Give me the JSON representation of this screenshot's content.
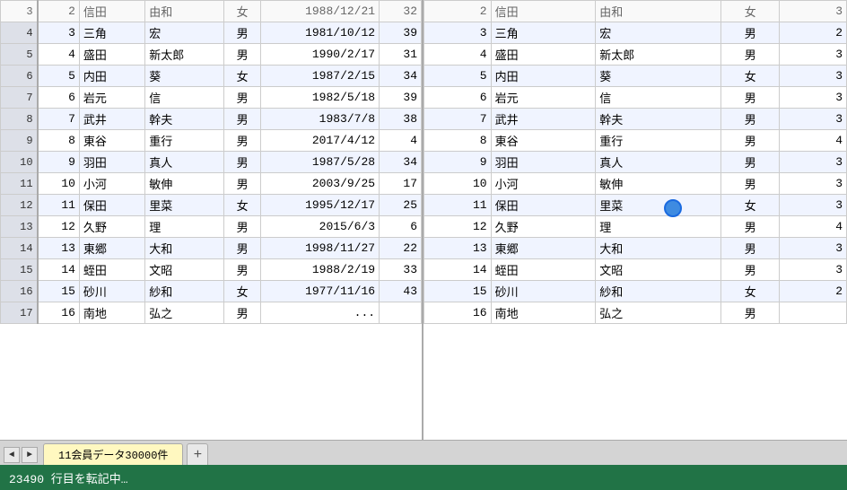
{
  "leftTable": {
    "rows": [
      {
        "rowNum": "3",
        "id": "2",
        "lastName": "信田",
        "firstName": "由和",
        "gender": "女",
        "date": "1988/12/21",
        "age": "32"
      },
      {
        "rowNum": "4",
        "id": "3",
        "lastName": "三角",
        "firstName": "宏",
        "gender": "男",
        "date": "1981/10/12",
        "age": "39"
      },
      {
        "rowNum": "5",
        "id": "4",
        "lastName": "盛田",
        "firstName": "新太郎",
        "gender": "男",
        "date": "1990/2/17",
        "age": "31"
      },
      {
        "rowNum": "6",
        "id": "5",
        "lastName": "内田",
        "firstName": "葵",
        "gender": "女",
        "date": "1987/2/15",
        "age": "34"
      },
      {
        "rowNum": "7",
        "id": "6",
        "lastName": "岩元",
        "firstName": "信",
        "gender": "男",
        "date": "1982/5/18",
        "age": "39"
      },
      {
        "rowNum": "8",
        "id": "7",
        "lastName": "武井",
        "firstName": "幹夫",
        "gender": "男",
        "date": "1983/7/8",
        "age": "38"
      },
      {
        "rowNum": "9",
        "id": "8",
        "lastName": "東谷",
        "firstName": "重行",
        "gender": "男",
        "date": "2017/4/12",
        "age": "4"
      },
      {
        "rowNum": "10",
        "id": "9",
        "lastName": "羽田",
        "firstName": "真人",
        "gender": "男",
        "date": "1987/5/28",
        "age": "34"
      },
      {
        "rowNum": "11",
        "id": "10",
        "lastName": "小河",
        "firstName": "敏伸",
        "gender": "男",
        "date": "2003/9/25",
        "age": "17"
      },
      {
        "rowNum": "12",
        "id": "11",
        "lastName": "保田",
        "firstName": "里菜",
        "gender": "女",
        "date": "1995/12/17",
        "age": "25"
      },
      {
        "rowNum": "13",
        "id": "12",
        "lastName": "久野",
        "firstName": "理",
        "gender": "男",
        "date": "2015/6/3",
        "age": "6"
      },
      {
        "rowNum": "14",
        "id": "13",
        "lastName": "東郷",
        "firstName": "大和",
        "gender": "男",
        "date": "1998/11/27",
        "age": "22"
      },
      {
        "rowNum": "15",
        "id": "14",
        "lastName": "蛭田",
        "firstName": "文昭",
        "gender": "男",
        "date": "1988/2/19",
        "age": "33"
      },
      {
        "rowNum": "16",
        "id": "15",
        "lastName": "砂川",
        "firstName": "紗和",
        "gender": "女",
        "date": "1977/11/16",
        "age": "43"
      },
      {
        "rowNum": "17",
        "id": "16",
        "lastName": "南地",
        "firstName": "弘之",
        "gender": "男",
        "date": "...",
        "age": ""
      }
    ]
  },
  "rightTable": {
    "rows": [
      {
        "id": "2",
        "lastName": "信田",
        "firstName": "由和",
        "gender": "女",
        "age": "3"
      },
      {
        "id": "3",
        "lastName": "三角",
        "firstName": "宏",
        "gender": "男",
        "age": "2"
      },
      {
        "id": "4",
        "lastName": "盛田",
        "firstName": "新太郎",
        "gender": "男",
        "age": "3"
      },
      {
        "id": "5",
        "lastName": "内田",
        "firstName": "葵",
        "gender": "女",
        "age": "3"
      },
      {
        "id": "6",
        "lastName": "岩元",
        "firstName": "信",
        "gender": "男",
        "age": "3"
      },
      {
        "id": "7",
        "lastName": "武井",
        "firstName": "幹夫",
        "gender": "男",
        "age": "3"
      },
      {
        "id": "8",
        "lastName": "東谷",
        "firstName": "重行",
        "gender": "男",
        "age": "4"
      },
      {
        "id": "9",
        "lastName": "羽田",
        "firstName": "真人",
        "gender": "男",
        "age": "3"
      },
      {
        "id": "10",
        "lastName": "小河",
        "firstName": "敏伸",
        "gender": "男",
        "age": "3"
      },
      {
        "id": "11",
        "lastName": "保田",
        "firstName": "里菜",
        "gender": "女",
        "age": "3"
      },
      {
        "id": "12",
        "lastName": "久野",
        "firstName": "理",
        "gender": "男",
        "age": "4"
      },
      {
        "id": "13",
        "lastName": "東郷",
        "firstName": "大和",
        "gender": "男",
        "age": "3"
      },
      {
        "id": "14",
        "lastName": "蛭田",
        "firstName": "文昭",
        "gender": "男",
        "age": "3"
      },
      {
        "id": "15",
        "lastName": "砂川",
        "firstName": "紗和",
        "gender": "女",
        "age": "2"
      },
      {
        "id": "16",
        "lastName": "南地",
        "firstName": "弘之",
        "gender": "男",
        "age": ""
      }
    ]
  },
  "tabBar": {
    "prevArrow": "◄",
    "nextArrow": "►",
    "tabLabel": "11会員データ30000件",
    "addButton": "+"
  },
  "statusBar": {
    "message": "23490 行目を転記中…"
  }
}
